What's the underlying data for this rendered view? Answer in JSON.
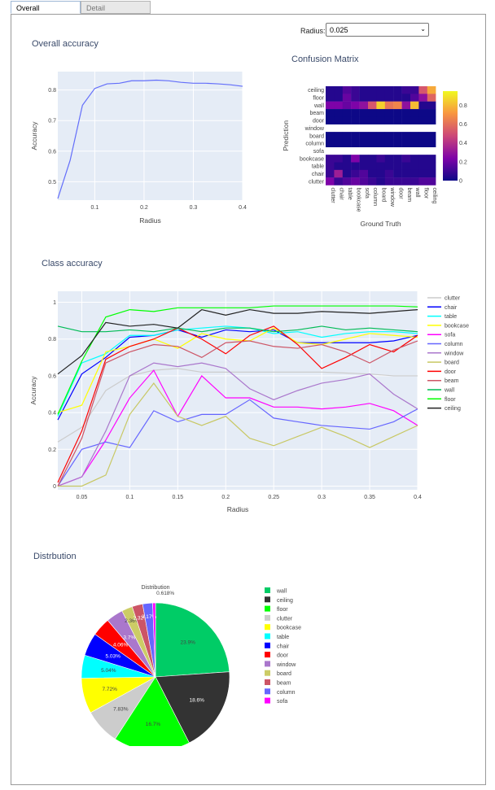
{
  "tabs": [
    {
      "label": "Overall"
    },
    {
      "label": "Detail"
    }
  ],
  "radius_control": {
    "label": "Radius:",
    "value": "0.025"
  },
  "overall_accuracy": {
    "title": "Overall accuracy",
    "chart_data": {
      "type": "line",
      "x": [
        0.025,
        0.05,
        0.075,
        0.1,
        0.125,
        0.15,
        0.175,
        0.2,
        0.225,
        0.25,
        0.275,
        0.3,
        0.325,
        0.35,
        0.375,
        0.4
      ],
      "y": [
        0.445,
        0.57,
        0.75,
        0.805,
        0.82,
        0.822,
        0.83,
        0.83,
        0.832,
        0.83,
        0.825,
        0.822,
        0.822,
        0.82,
        0.817,
        0.812
      ],
      "xlabel": "Radius",
      "ylabel": "Accuracy",
      "xlim": [
        0.025,
        0.4
      ],
      "ylim": [
        0.44,
        0.86
      ],
      "xticks": [
        "0.1",
        "0.2",
        "0.3",
        "0.4"
      ],
      "yticks": [
        "0.5",
        "0.6",
        "0.7",
        "0.8"
      ],
      "color": "#636efa"
    }
  },
  "confusion": {
    "title": "Confusion Matrix",
    "chart_data": {
      "type": "heatmap",
      "rows": [
        "ceiling",
        "floor",
        "wall",
        "beam",
        "door",
        "window",
        "board",
        "column",
        "sofa",
        "bookcase",
        "table",
        "chair",
        "clutter"
      ],
      "cols": [
        "clutter",
        "chair",
        "table",
        "bookcase",
        "sofa",
        "column",
        "board",
        "window",
        "door",
        "beam",
        "wall",
        "floor",
        "ceiling"
      ],
      "values": [
        [
          0.05,
          0.05,
          0.15,
          0.1,
          0.05,
          0.05,
          0.05,
          0.05,
          0.05,
          0.1,
          0.1,
          0.55,
          0.8
        ],
        [
          0.05,
          0.05,
          0.2,
          0.1,
          0.05,
          0.05,
          0.05,
          0.05,
          0.05,
          0.05,
          0.15,
          0.3,
          0.6
        ],
        [
          0.25,
          0.25,
          0.2,
          0.25,
          0.3,
          0.55,
          0.9,
          0.65,
          0.7,
          0.3,
          0.85,
          0.05,
          0.05
        ],
        [
          0.0,
          0.0,
          0.0,
          0.0,
          0.0,
          0.0,
          0.0,
          0.0,
          0.0,
          0.0,
          0.0,
          0.0,
          0.0
        ],
        [
          0.0,
          0.0,
          0.0,
          0.0,
          0.0,
          0.0,
          0.0,
          0.0,
          0.0,
          0.0,
          0.0,
          0.0,
          0.0
        ],
        [
          null,
          null,
          null,
          null,
          null,
          null,
          null,
          null,
          null,
          null,
          null,
          null,
          null
        ],
        [
          0.0,
          0.0,
          0.0,
          0.0,
          0.0,
          0.0,
          0.0,
          0.0,
          0.0,
          0.0,
          0.0,
          0.0,
          0.0
        ],
        [
          0.0,
          0.0,
          0.0,
          0.0,
          0.0,
          0.0,
          0.0,
          0.0,
          0.0,
          0.0,
          0.0,
          0.0,
          0.0
        ],
        [
          null,
          null,
          null,
          null,
          null,
          null,
          null,
          null,
          null,
          null,
          null,
          null,
          null
        ],
        [
          0.1,
          0.1,
          0.05,
          0.25,
          0.05,
          0.05,
          0.1,
          0.05,
          0.05,
          0.1,
          0.05,
          0.05,
          0.05
        ],
        [
          0.1,
          0.05,
          0.05,
          0.05,
          0.05,
          0.05,
          0.05,
          0.05,
          0.05,
          0.05,
          0.05,
          0.05,
          0.05
        ],
        [
          0.1,
          0.35,
          0.05,
          0.1,
          0.15,
          0.05,
          0.05,
          0.1,
          0.05,
          0.05,
          0.05,
          0.05,
          0.05
        ],
        [
          0.25,
          0.1,
          0.15,
          0.2,
          0.15,
          0.1,
          0.05,
          0.1,
          0.1,
          0.1,
          0.1,
          0.15,
          0.15
        ]
      ],
      "xlabel": "Ground Truth",
      "ylabel": "Prediction",
      "colorbar": [
        "0",
        "0.2",
        "0.4",
        "0.6",
        "0.8"
      ]
    }
  },
  "class_accuracy": {
    "title": "Class accuracy",
    "chart_data": {
      "type": "line",
      "x": [
        0.025,
        0.05,
        0.075,
        0.1,
        0.125,
        0.15,
        0.175,
        0.2,
        0.225,
        0.25,
        0.275,
        0.3,
        0.325,
        0.35,
        0.375,
        0.4
      ],
      "xlabel": "Radius",
      "ylabel": "Accuracy",
      "xlim": [
        0.025,
        0.4
      ],
      "ylim": [
        -0.02,
        1.06
      ],
      "xticks": [
        "0.05",
        "0.1",
        "0.15",
        "0.2",
        "0.25",
        "0.3",
        "0.35",
        "0.4"
      ],
      "yticks": [
        "0",
        "0.2",
        "0.4",
        "0.6",
        "0.8",
        "1"
      ],
      "series": [
        {
          "name": "clutter",
          "color": "#cccccc",
          "values": [
            0.24,
            0.32,
            0.52,
            0.6,
            0.63,
            0.64,
            0.62,
            0.62,
            0.62,
            0.62,
            0.62,
            0.62,
            0.615,
            0.61,
            0.6,
            0.6
          ]
        },
        {
          "name": "chair",
          "color": "#0000ff",
          "values": [
            0.36,
            0.61,
            0.7,
            0.81,
            0.82,
            0.85,
            0.81,
            0.85,
            0.84,
            0.85,
            0.78,
            0.78,
            0.78,
            0.78,
            0.79,
            0.82
          ]
        },
        {
          "name": "table",
          "color": "#00ffff",
          "values": [
            0.38,
            0.67,
            0.72,
            0.82,
            0.82,
            0.85,
            0.86,
            0.87,
            0.86,
            0.83,
            0.84,
            0.81,
            0.83,
            0.84,
            0.84,
            0.83
          ]
        },
        {
          "name": "bookcase",
          "color": "#ffff00",
          "values": [
            0.4,
            0.44,
            0.73,
            0.76,
            0.8,
            0.75,
            0.83,
            0.8,
            0.79,
            0.86,
            0.78,
            0.77,
            0.8,
            0.83,
            0.82,
            0.81
          ]
        },
        {
          "name": "sofa",
          "color": "#ff00ff",
          "values": [
            0.0,
            0.05,
            0.25,
            0.48,
            0.63,
            0.38,
            0.6,
            0.48,
            0.48,
            0.43,
            0.43,
            0.42,
            0.43,
            0.45,
            0.41,
            0.33
          ]
        },
        {
          "name": "column",
          "color": "#6666ff",
          "values": [
            0.0,
            0.2,
            0.24,
            0.21,
            0.41,
            0.35,
            0.39,
            0.39,
            0.47,
            0.37,
            0.35,
            0.33,
            0.32,
            0.31,
            0.35,
            0.42
          ]
        },
        {
          "name": "window",
          "color": "#aa77cc",
          "values": [
            0.0,
            0.05,
            0.3,
            0.6,
            0.67,
            0.65,
            0.67,
            0.64,
            0.53,
            0.47,
            0.52,
            0.56,
            0.58,
            0.61,
            0.5,
            0.42
          ]
        },
        {
          "name": "board",
          "color": "#c8c864",
          "values": [
            0.0,
            0.0,
            0.06,
            0.39,
            0.56,
            0.38,
            0.33,
            0.38,
            0.26,
            0.22,
            0.27,
            0.32,
            0.27,
            0.21,
            0.27,
            0.33
          ]
        },
        {
          "name": "door",
          "color": "#ff0000",
          "values": [
            0.02,
            0.3,
            0.69,
            0.76,
            0.8,
            0.86,
            0.8,
            0.72,
            0.82,
            0.87,
            0.77,
            0.64,
            0.7,
            0.77,
            0.73,
            0.82
          ]
        },
        {
          "name": "beam",
          "color": "#cc5566",
          "values": [
            0.0,
            0.26,
            0.67,
            0.73,
            0.77,
            0.76,
            0.7,
            0.78,
            0.79,
            0.76,
            0.75,
            0.77,
            0.73,
            0.67,
            0.74,
            0.79
          ]
        },
        {
          "name": "wall",
          "color": "#00bb55",
          "values": [
            0.87,
            0.84,
            0.84,
            0.85,
            0.84,
            0.86,
            0.84,
            0.86,
            0.86,
            0.84,
            0.85,
            0.87,
            0.85,
            0.86,
            0.85,
            0.84
          ]
        },
        {
          "name": "floor",
          "color": "#00ff00",
          "values": [
            0.39,
            0.68,
            0.92,
            0.96,
            0.95,
            0.97,
            0.97,
            0.97,
            0.97,
            0.98,
            0.98,
            0.98,
            0.98,
            0.98,
            0.98,
            0.975
          ]
        },
        {
          "name": "ceiling",
          "color": "#222222",
          "values": [
            0.61,
            0.71,
            0.89,
            0.87,
            0.88,
            0.86,
            0.96,
            0.93,
            0.96,
            0.94,
            0.94,
            0.95,
            0.945,
            0.94,
            0.95,
            0.96
          ]
        }
      ]
    }
  },
  "distribution": {
    "title": "Distrbution",
    "chart_data": {
      "type": "pie",
      "title": "Distribution",
      "slices": [
        {
          "label": "wall",
          "value": 23.9,
          "text": "23.9%",
          "color": "#00cc66"
        },
        {
          "label": "ceiling",
          "value": 18.6,
          "text": "18.6%",
          "color": "#333333"
        },
        {
          "label": "floor",
          "value": 16.7,
          "text": "16.7%",
          "color": "#00ff00"
        },
        {
          "label": "clutter",
          "value": 7.83,
          "text": "7.83%",
          "color": "#cccccc"
        },
        {
          "label": "bookcase",
          "value": 7.72,
          "text": "7.72%",
          "color": "#ffff00"
        },
        {
          "label": "table",
          "value": 5.04,
          "text": "5.04%",
          "color": "#00ffff"
        },
        {
          "label": "chair",
          "value": 5.03,
          "text": "5.03%",
          "color": "#0000ff"
        },
        {
          "label": "door",
          "value": 4.06,
          "text": "4.06%",
          "color": "#ff0000"
        },
        {
          "label": "window",
          "value": 3.7,
          "text": "3.7%",
          "color": "#aa77cc"
        },
        {
          "label": "board",
          "value": 2.36,
          "text": "2.36%",
          "color": "#cccc66"
        },
        {
          "label": "beam",
          "value": 2.32,
          "text": "2.32%",
          "color": "#cc5566"
        },
        {
          "label": "column",
          "value": 2.17,
          "text": "2.17%",
          "color": "#6666ff"
        },
        {
          "label": "sofa",
          "value": 0.618,
          "text": "0.618%",
          "color": "#ff00ff"
        }
      ]
    }
  }
}
